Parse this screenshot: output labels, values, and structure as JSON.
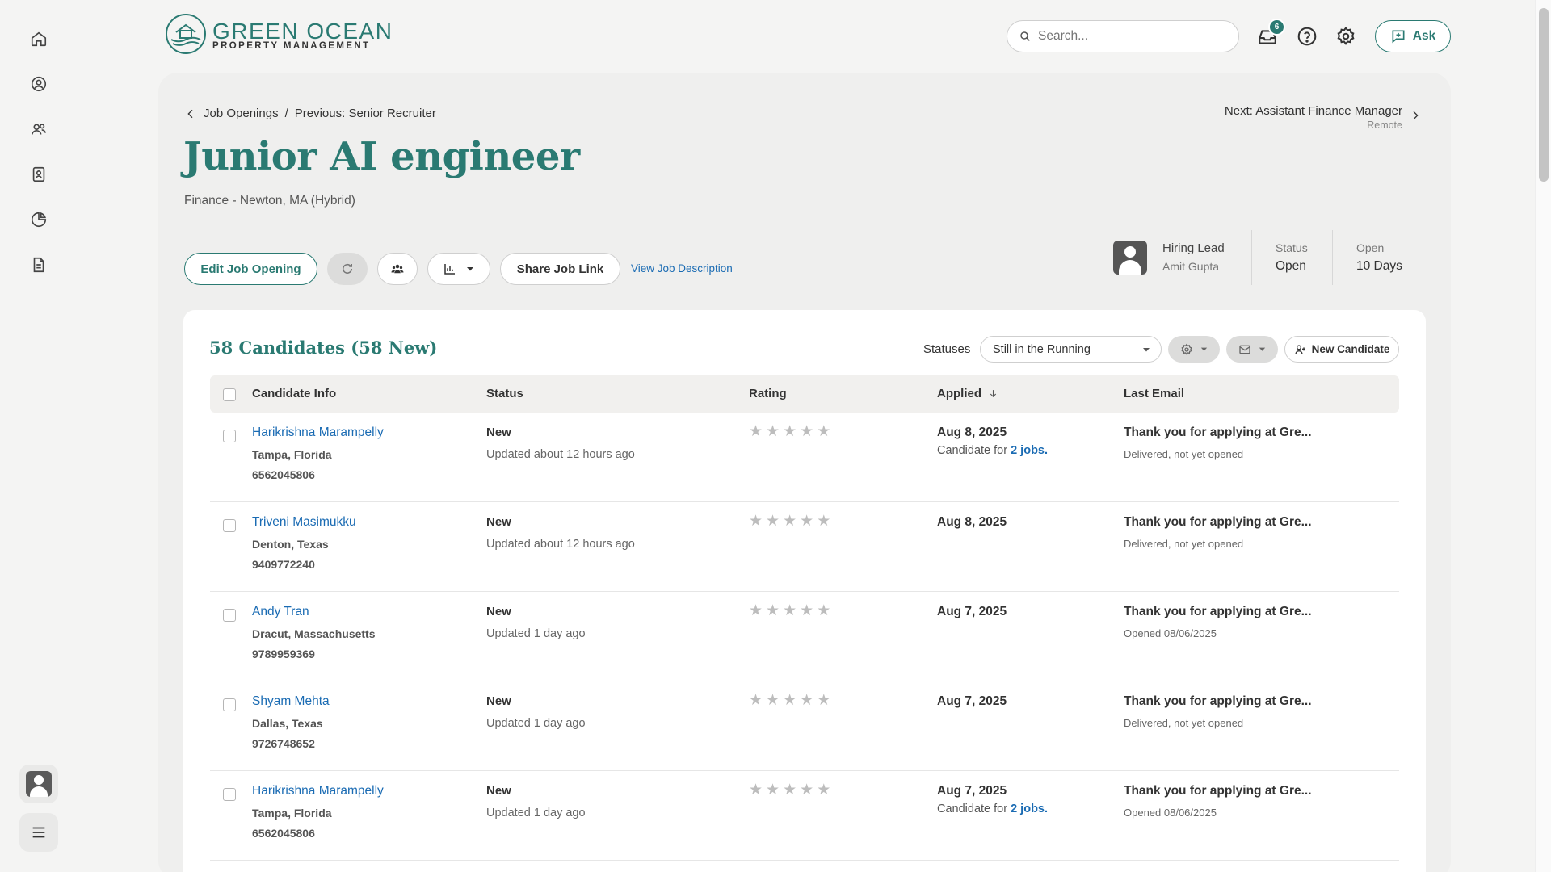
{
  "brand": {
    "line1": "GREEN OCEAN",
    "line2": "PROPERTY MANAGEMENT",
    "accent": "#2a7a72"
  },
  "header": {
    "search_placeholder": "Search...",
    "notification_count": "6",
    "ask_label": "Ask"
  },
  "sidebar": {
    "items": [
      "home-icon",
      "user-circle-icon",
      "people-icon",
      "id-card-icon",
      "pie-chart-icon",
      "document-icon"
    ]
  },
  "breadcrumb": {
    "parent": "Job Openings",
    "separator": "/",
    "previous": "Previous: Senior Recruiter"
  },
  "next": {
    "label": "Next: Assistant Finance Manager",
    "sub": "Remote"
  },
  "job": {
    "title": "Junior AI engineer",
    "subtitle": "Finance - Newton, MA (Hybrid)"
  },
  "actions": {
    "edit": "Edit Job Opening",
    "share": "Share Job Link",
    "view_desc": "View Job Description"
  },
  "meta": {
    "hiring_lead_label": "Hiring Lead",
    "hiring_lead_value": "Amit Gupta",
    "status_label": "Status",
    "status_value": "Open",
    "open_label": "Open",
    "open_value": "10 Days"
  },
  "candidates": {
    "heading": "58 Candidates (58 New)",
    "statuses_label": "Statuses",
    "status_filter": "Still in the Running",
    "new_candidate": "New Candidate",
    "columns": {
      "info": "Candidate Info",
      "status": "Status",
      "rating": "Rating",
      "applied": "Applied",
      "email": "Last Email"
    },
    "rows": [
      {
        "name": "Harikrishna Marampelly",
        "location": "Tampa, Florida",
        "phone": "6562045806",
        "status": "New",
        "updated": "Updated about 12 hours ago",
        "rating": 0,
        "date": "Aug 8, 2025",
        "cand_for_prefix": "Candidate for",
        "cand_for_link": "2 jobs.",
        "email": "Thank you for applying at Gre...",
        "email_sub": "Delivered, not yet opened"
      },
      {
        "name": "Triveni Masimukku",
        "location": "Denton, Texas",
        "phone": "9409772240",
        "status": "New",
        "updated": "Updated about 12 hours ago",
        "rating": 0,
        "date": "Aug 8, 2025",
        "email": "Thank you for applying at Gre...",
        "email_sub": "Delivered, not yet opened"
      },
      {
        "name": "Andy Tran",
        "location": "Dracut, Massachusetts",
        "phone": "9789959369",
        "status": "New",
        "updated": "Updated 1 day ago",
        "rating": 0,
        "date": "Aug 7, 2025",
        "email": "Thank you for applying at Gre...",
        "email_sub": "Opened 08/06/2025"
      },
      {
        "name": "Shyam Mehta",
        "location": "Dallas, Texas",
        "phone": "9726748652",
        "status": "New",
        "updated": "Updated 1 day ago",
        "rating": 0,
        "date": "Aug 7, 2025",
        "email": "Thank you for applying at Gre...",
        "email_sub": "Delivered, not yet opened"
      },
      {
        "name": "Harikrishna Marampelly",
        "location": "Tampa, Florida",
        "phone": "6562045806",
        "status": "New",
        "updated": "Updated 1 day ago",
        "rating": 0,
        "date": "Aug 7, 2025",
        "cand_for_prefix": "Candidate for",
        "cand_for_link": "2 jobs.",
        "email": "Thank you for applying at Gre...",
        "email_sub": "Opened 08/06/2025"
      }
    ]
  }
}
